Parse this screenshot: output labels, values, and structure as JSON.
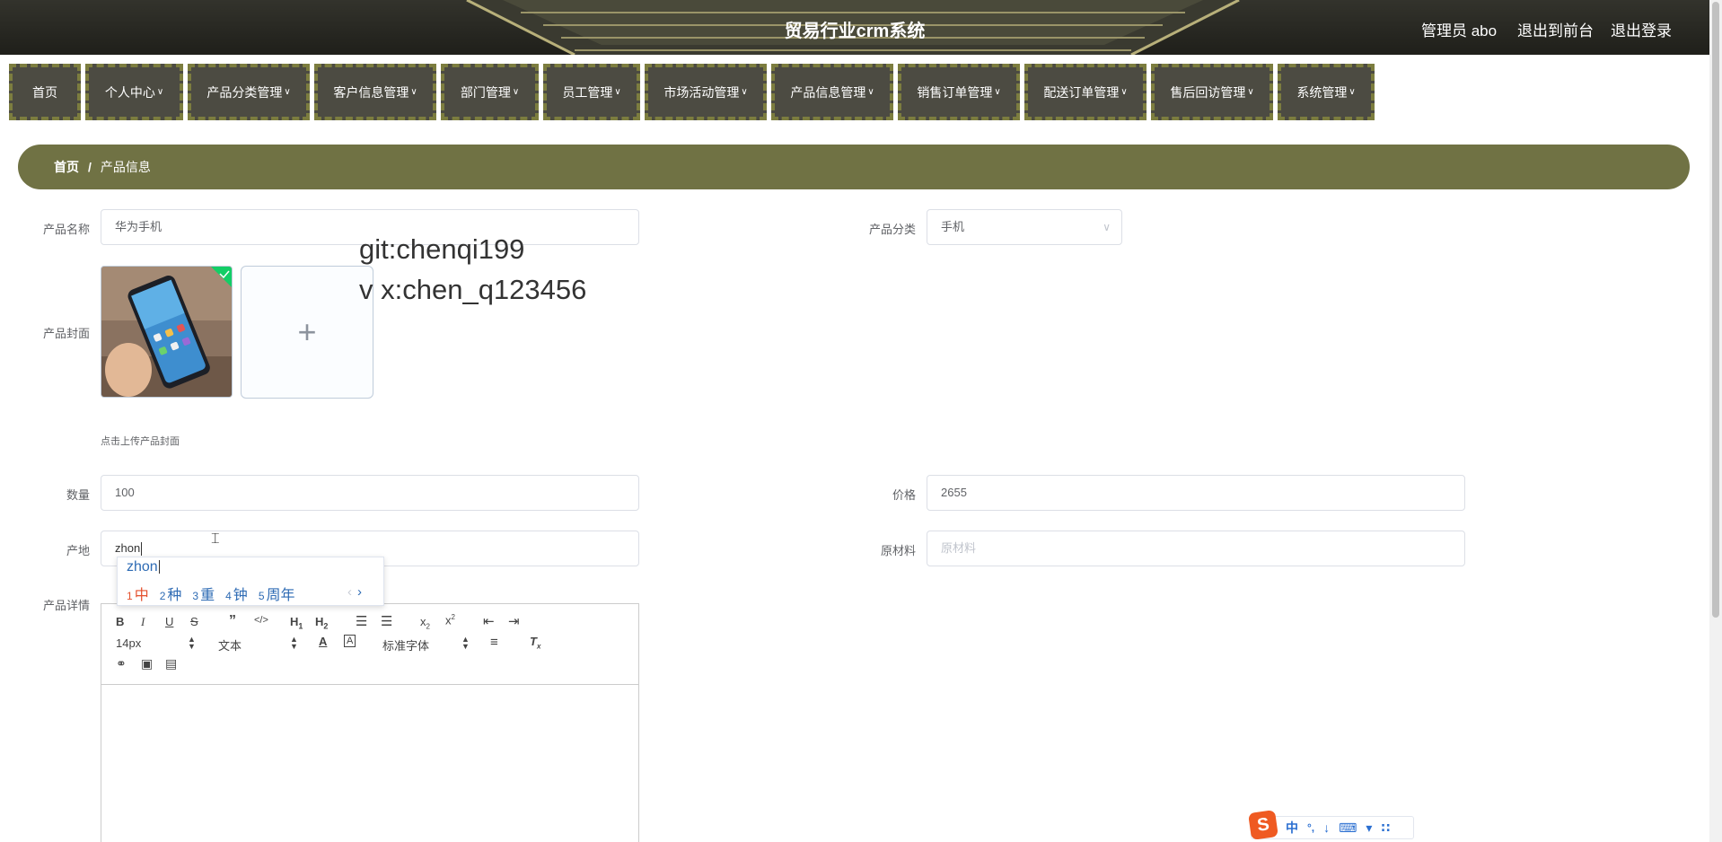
{
  "header": {
    "title": "贸易行业crm系统",
    "admin_label": "管理员 abo",
    "to_front": "退出到前台",
    "logout": "退出登录"
  },
  "nav": {
    "items": [
      {
        "label": "首页",
        "has_menu": false
      },
      {
        "label": "个人中心",
        "has_menu": true
      },
      {
        "label": "产品分类管理",
        "has_menu": true
      },
      {
        "label": "客户信息管理",
        "has_menu": true
      },
      {
        "label": "部门管理",
        "has_menu": true
      },
      {
        "label": "员工管理",
        "has_menu": true
      },
      {
        "label": "市场活动管理",
        "has_menu": true
      },
      {
        "label": "产品信息管理",
        "has_menu": true
      },
      {
        "label": "销售订单管理",
        "has_menu": true
      },
      {
        "label": "配送订单管理",
        "has_menu": true
      },
      {
        "label": "售后回访管理",
        "has_menu": true
      },
      {
        "label": "系统管理",
        "has_menu": true
      }
    ]
  },
  "breadcrumb": {
    "home": "首页",
    "separator": "/",
    "current": "产品信息"
  },
  "form": {
    "name": {
      "label": "产品名称",
      "value": "华为手机"
    },
    "category": {
      "label": "产品分类",
      "value": "手机"
    },
    "cover": {
      "label": "产品封面",
      "tip": "点击上传产品封面",
      "add_icon": "+"
    },
    "quantity": {
      "label": "数量",
      "value": "100"
    },
    "price": {
      "label": "价格",
      "value": "2655"
    },
    "origin": {
      "label": "产地",
      "value": "zhon"
    },
    "material": {
      "label": "原材料",
      "placeholder": "原材料"
    },
    "detail": {
      "label": "产品详情"
    }
  },
  "editor": {
    "font_size": "14px",
    "header_select": "文本",
    "font_family": "标准字体"
  },
  "watermark": {
    "line1": "git:chenqi199",
    "line2": "v x:chen_q123456"
  },
  "ime": {
    "pinyin": "zhon",
    "candidates": [
      {
        "n": "1",
        "text": "中"
      },
      {
        "n": "2",
        "text": "种"
      },
      {
        "n": "3",
        "text": "重"
      },
      {
        "n": "4",
        "text": "钟"
      },
      {
        "n": "5",
        "text": "周年"
      }
    ]
  },
  "tray": {
    "logo": "S",
    "mode": "中",
    "punct": "°,"
  }
}
